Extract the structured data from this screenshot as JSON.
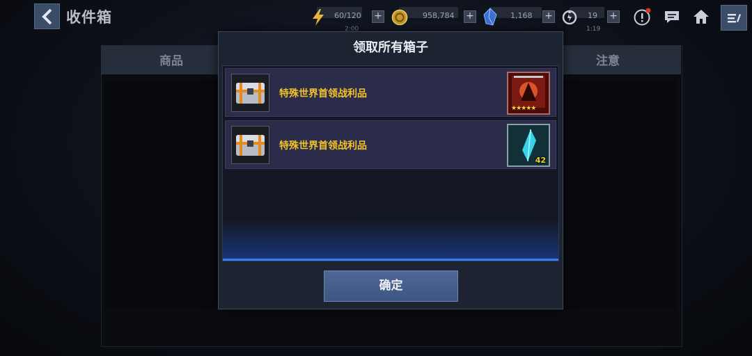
{
  "header": {
    "title": "收件箱",
    "stamina": {
      "value": "60/120",
      "timer": "2:00"
    },
    "gold": {
      "value": "958,784"
    },
    "crystal": {
      "value": "1,168"
    },
    "energy": {
      "value": "19",
      "timer": "1:19"
    },
    "plus_label": "+"
  },
  "inbox": {
    "column_left": "商品",
    "column_right": "注意"
  },
  "dialog": {
    "title": "领取所有箱子",
    "items": [
      {
        "name": "特殊世界首领战利品",
        "reward_icon": "character-card-icon",
        "reward_stars": 5
      },
      {
        "name": "特殊世界首领战利品",
        "reward_icon": "crystal-shard-icon",
        "reward_count": "42"
      }
    ],
    "confirm_label": "确定"
  },
  "colors": {
    "accent_blue": "#3c7cf0",
    "item_name_gold": "#f2c22a",
    "button_blue": "#4f6897"
  }
}
